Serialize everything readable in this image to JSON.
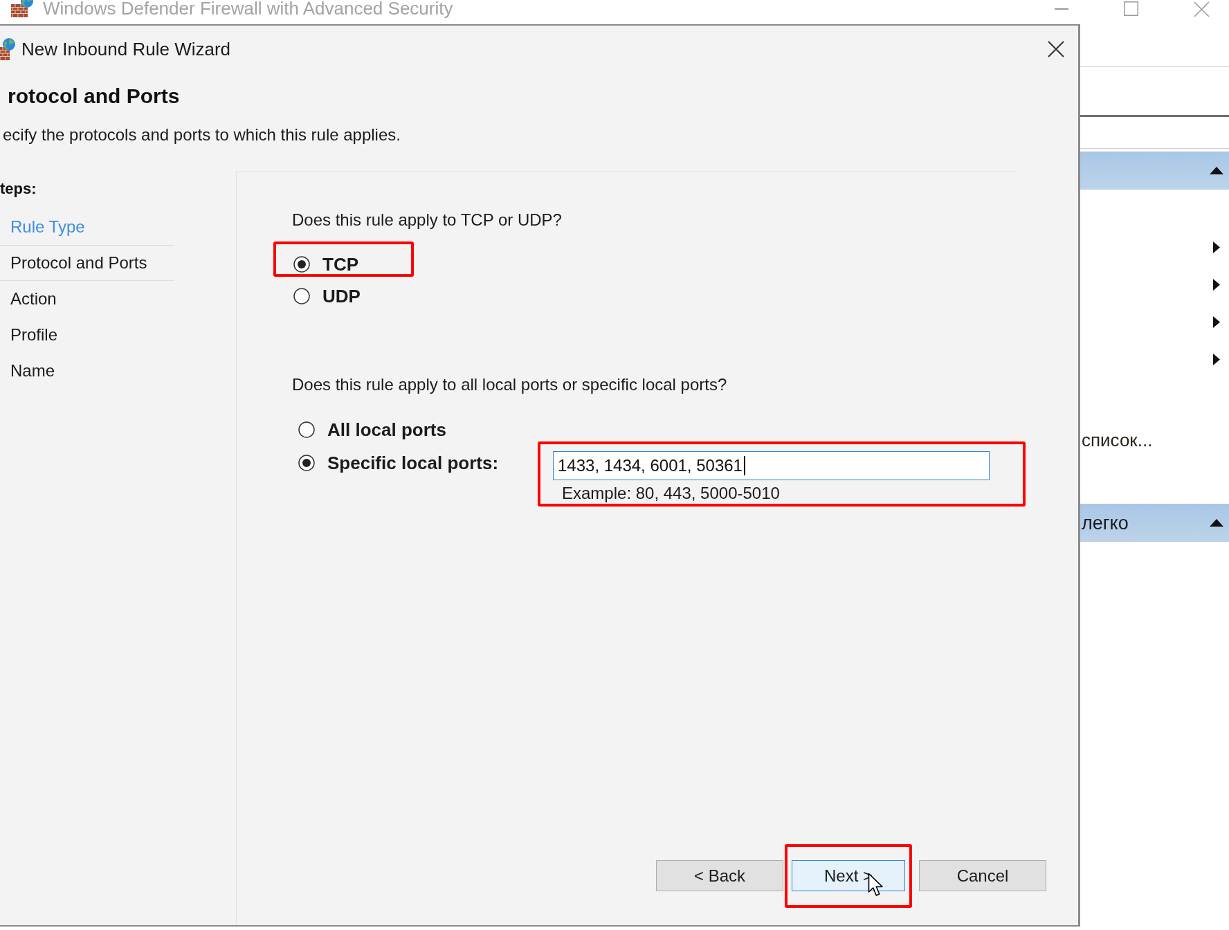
{
  "window": {
    "title": "Windows Defender Firewall with Advanced Security"
  },
  "dialog": {
    "title": "New Inbound Rule Wizard",
    "heading": "rotocol and Ports",
    "description": "ecify the protocols and ports to which this rule applies.",
    "steps_label": "teps:",
    "steps": [
      {
        "label": "Rule Type",
        "completed": true,
        "selected": false
      },
      {
        "label": "Protocol and Ports",
        "completed": false,
        "selected": true
      },
      {
        "label": "Action",
        "completed": false,
        "selected": false
      },
      {
        "label": "Profile",
        "completed": false,
        "selected": false
      },
      {
        "label": "Name",
        "completed": false,
        "selected": false
      }
    ],
    "protocol": {
      "question": "Does this rule apply to TCP or UDP?",
      "options": [
        {
          "label": "TCP",
          "selected": true,
          "highlighted": true
        },
        {
          "label": "UDP",
          "selected": false,
          "highlighted": false
        }
      ]
    },
    "ports": {
      "question": "Does this rule apply to all local ports or specific local ports?",
      "options": [
        {
          "kind": "all",
          "label": "All local ports",
          "selected": false
        },
        {
          "kind": "specific",
          "label": "Specific local ports:",
          "selected": true
        }
      ],
      "field": {
        "value": "1433, 1434, 6001, 50361",
        "focused": true,
        "highlighted": true
      },
      "example": "Example: 80, 443, 5000-5010"
    },
    "buttons": [
      {
        "label": "< Back",
        "focused": false,
        "highlighted": false,
        "pointer": false
      },
      {
        "label": "Next >",
        "focused": true,
        "highlighted": true,
        "pointer": true
      },
      {
        "label": "Cancel",
        "focused": false,
        "highlighted": false,
        "pointer": false
      }
    ]
  },
  "actions_pane": {
    "sections": [
      {
        "expanded": true,
        "items": [
          {
            "kind": "submenu"
          },
          {
            "kind": "submenu"
          },
          {
            "kind": "submenu"
          },
          {
            "kind": "submenu"
          },
          {
            "kind": "action",
            "label": "список..."
          }
        ]
      },
      {
        "title": "легко",
        "expanded": true
      }
    ]
  }
}
